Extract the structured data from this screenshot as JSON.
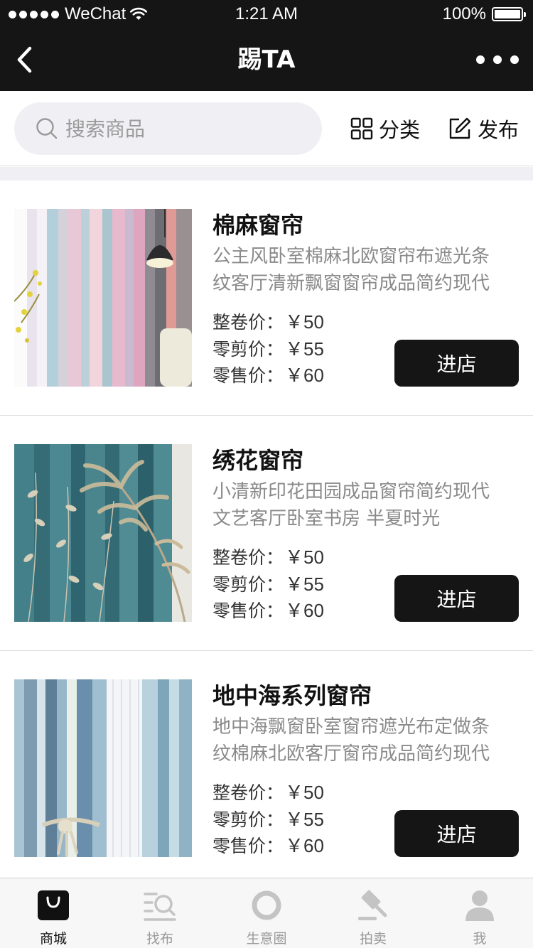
{
  "status_bar": {
    "carrier": "WeChat",
    "time": "1:21 AM",
    "battery": "100%",
    "battery_level": 1.0
  },
  "nav": {
    "title": "踢TA",
    "back_icon": "chevron-left-icon",
    "more_icon": "more-dots-icon"
  },
  "search": {
    "placeholder": "搜索商品",
    "icon": "search-icon"
  },
  "actions": {
    "category_label": "分类",
    "category_icon": "grid-icon",
    "publish_label": "发布",
    "publish_icon": "edit-icon"
  },
  "products": [
    {
      "title": "棉麻窗帘",
      "desc_line1": "公主风卧室棉麻北欧窗帘布遮光条",
      "desc_line2": "纹客厅清新飘窗窗帘成品简约现代",
      "price_whole_label": "整卷价：",
      "price_whole": "￥50",
      "price_cut_label": "零剪价：",
      "price_cut": "￥55",
      "price_retail_label": "零售价：",
      "price_retail": "￥60",
      "button": "进店"
    },
    {
      "title": "绣花窗帘",
      "desc_line1": "小清新印花田园成品窗帘简约现代",
      "desc_line2": "文艺客厅卧室书房 半夏时光",
      "price_whole_label": "整卷价：",
      "price_whole": "￥50",
      "price_cut_label": "零剪价：",
      "price_cut": "￥55",
      "price_retail_label": "零售价：",
      "price_retail": "￥60",
      "button": "进店"
    },
    {
      "title": "地中海系列窗帘",
      "desc_line1": "地中海飘窗卧室窗帘遮光布定做条",
      "desc_line2": "纹棉麻北欧客厅窗帘成品简约现代",
      "price_whole_label": "整卷价：",
      "price_whole": "￥50",
      "price_cut_label": "零剪价：",
      "price_cut": "￥55",
      "price_retail_label": "零售价：",
      "price_retail": "￥60",
      "button": "进店"
    }
  ],
  "tabs": [
    {
      "label": "商城",
      "icon": "shopping-bag-icon",
      "active": true
    },
    {
      "label": "找布",
      "icon": "search-list-icon",
      "active": false
    },
    {
      "label": "生意圈",
      "icon": "circle-icon",
      "active": false
    },
    {
      "label": "拍卖",
      "icon": "gavel-icon",
      "active": false
    },
    {
      "label": "我",
      "icon": "person-icon",
      "active": false
    }
  ],
  "colors": {
    "bar_background": "#151515",
    "search_background": "#f0f0f4",
    "active_tab": "#111111",
    "inactive_tab": "#999999"
  }
}
